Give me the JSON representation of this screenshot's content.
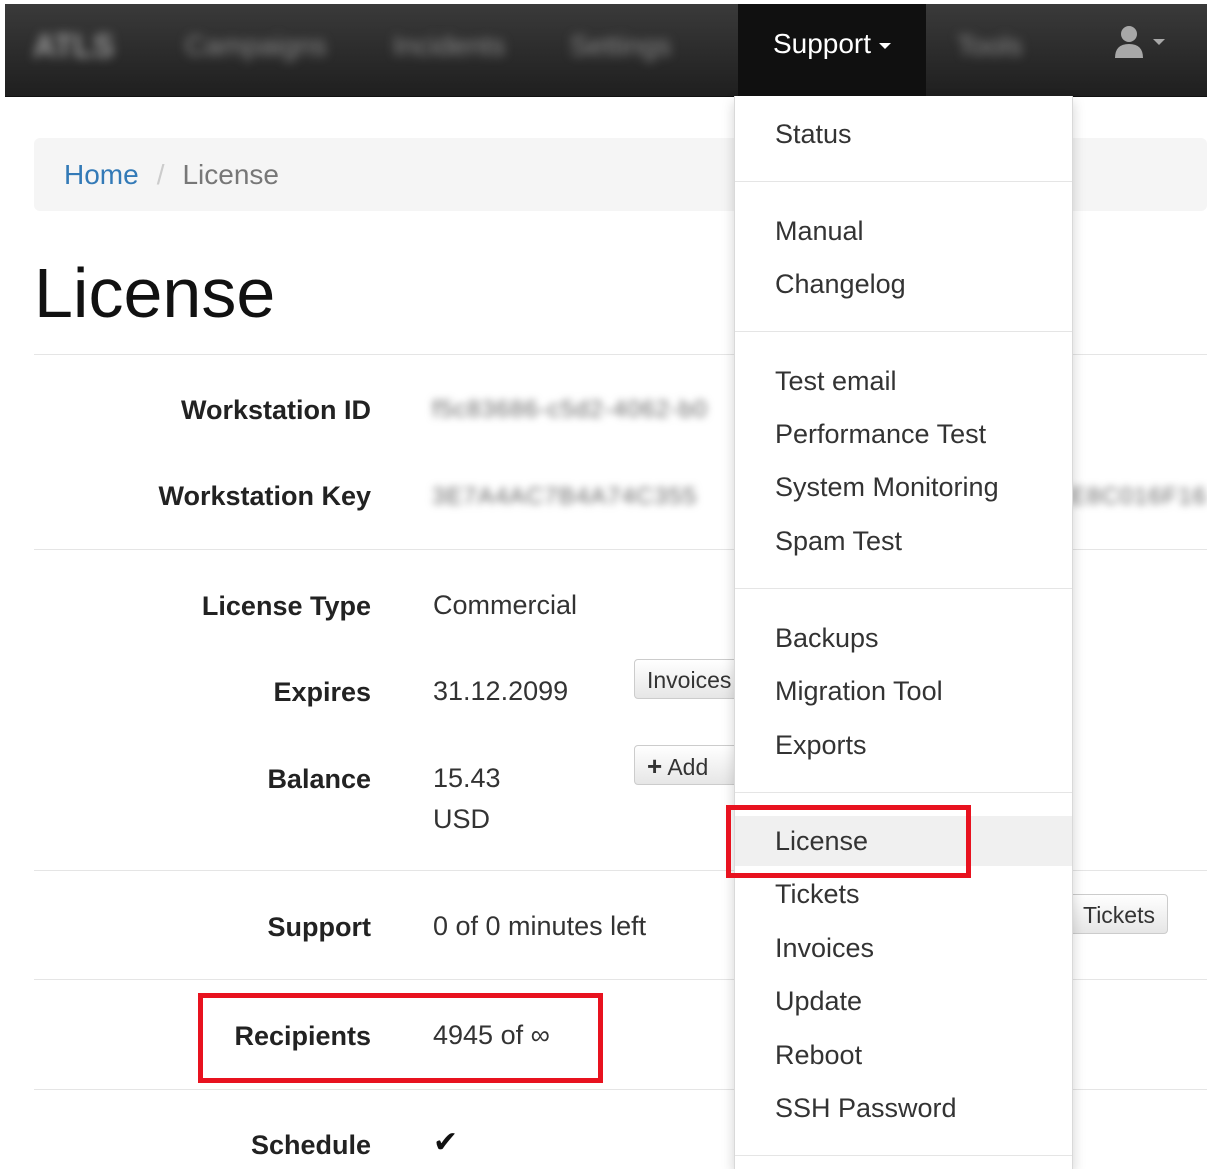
{
  "navbar": {
    "brand": "ATLS",
    "items": [
      "Campaigns",
      "Incidents",
      "Settings"
    ],
    "support_label": "Support",
    "tools_label": "Tools"
  },
  "breadcrumb": {
    "home": "Home",
    "separator": "/",
    "current": "License"
  },
  "page_title": "License",
  "fields": {
    "workstation_id": {
      "label": "Workstation ID",
      "value": "f5c83686-c5d2-4062-b0"
    },
    "workstation_key": {
      "label": "Workstation Key",
      "value": "3E7A4AC7B4A74C355",
      "value_right": "E8C016F16"
    },
    "license_type": {
      "label": "License Type",
      "value": "Commercial"
    },
    "expires": {
      "label": "Expires",
      "value": "31.12.2099",
      "button": "Invoices"
    },
    "balance": {
      "label": "Balance",
      "amount": "15.43",
      "currency": "USD",
      "button": "Add"
    },
    "support": {
      "label": "Support",
      "value": "0 of 0 minutes left",
      "button": "Tickets"
    },
    "recipients": {
      "label": "Recipients",
      "value": "4945 of ∞"
    },
    "schedule": {
      "label": "Schedule",
      "value": "✔"
    }
  },
  "dropdown": {
    "groups": [
      [
        "Status"
      ],
      [
        "Manual",
        "Changelog"
      ],
      [
        "Test email",
        "Performance Test",
        "System Monitoring",
        "Spam Test"
      ],
      [
        "Backups",
        "Migration Tool",
        "Exports"
      ],
      [
        "License",
        "Tickets",
        "Invoices",
        "Update",
        "Reboot",
        "SSH Password"
      ]
    ],
    "active_item": "License"
  },
  "highlight_color": "#e8121f",
  "link_color": "#337ab7"
}
